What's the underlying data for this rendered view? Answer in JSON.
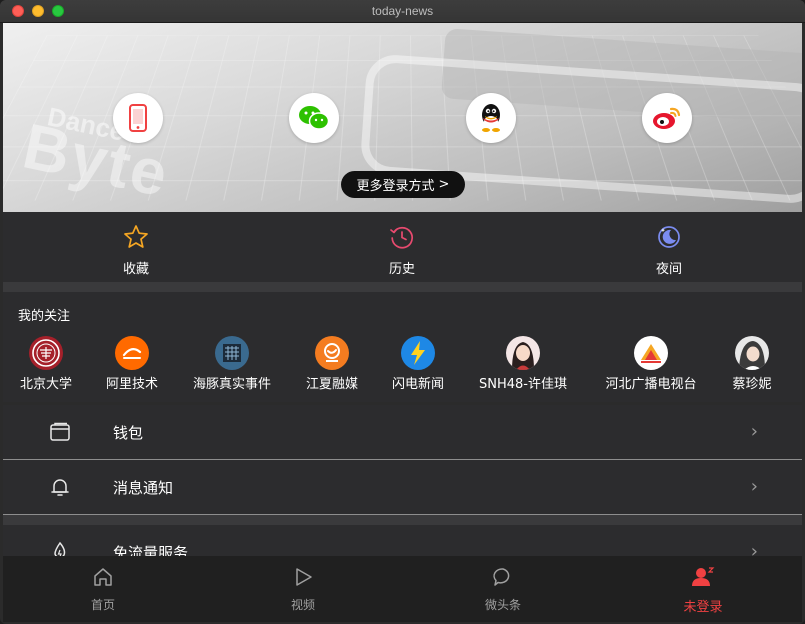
{
  "window": {
    "title": "today-news"
  },
  "banner": {
    "decor_word": "Byte",
    "decor_word_small": "Dance",
    "login_methods": [
      {
        "icon": "phone-icon",
        "color": "#f04142"
      },
      {
        "icon": "wechat-icon",
        "color": "#2dc100"
      },
      {
        "icon": "qq-icon",
        "color": "#1a1a1a"
      },
      {
        "icon": "weibo-icon",
        "color": "#e6162d"
      }
    ],
    "more_login_label": "更多登录方式",
    "more_login_arrow": ">"
  },
  "quick_actions": [
    {
      "label": "收藏",
      "icon": "star-icon",
      "color": "#f5a623"
    },
    {
      "label": "历史",
      "icon": "history-icon",
      "color": "#e84a6f"
    },
    {
      "label": "夜间",
      "icon": "night-mode-icon",
      "color": "#7b8cf0"
    }
  ],
  "follow": {
    "title": "我的关注",
    "items": [
      {
        "name": "北京大学"
      },
      {
        "name": "阿里技术"
      },
      {
        "name": "海豚真实事件"
      },
      {
        "name": "江夏融媒"
      },
      {
        "name": "闪电新闻"
      },
      {
        "name": "SNH48-许佳琪"
      },
      {
        "name": "河北广播电视台"
      },
      {
        "name": "蔡珍妮"
      }
    ]
  },
  "menu": {
    "wallet": {
      "label": "钱包",
      "icon": "wallet-icon",
      "chevron": "›"
    },
    "notifications": {
      "label": "消息通知",
      "icon": "bell-icon",
      "chevron": "›"
    },
    "data_free": {
      "label": "免流量服务",
      "icon": "flame-icon",
      "chevron": "›"
    }
  },
  "tabbar": [
    {
      "label": "首页",
      "icon": "home-icon",
      "active": false
    },
    {
      "label": "视频",
      "icon": "play-icon",
      "active": false
    },
    {
      "label": "微头条",
      "icon": "chat-bubble-icon",
      "active": false
    },
    {
      "label": "未登录",
      "icon": "user-icon",
      "active": true
    }
  ],
  "colors": {
    "accent": "#f04142",
    "background": "#2c2c2e",
    "tab_inactive": "#a0a0a0"
  }
}
